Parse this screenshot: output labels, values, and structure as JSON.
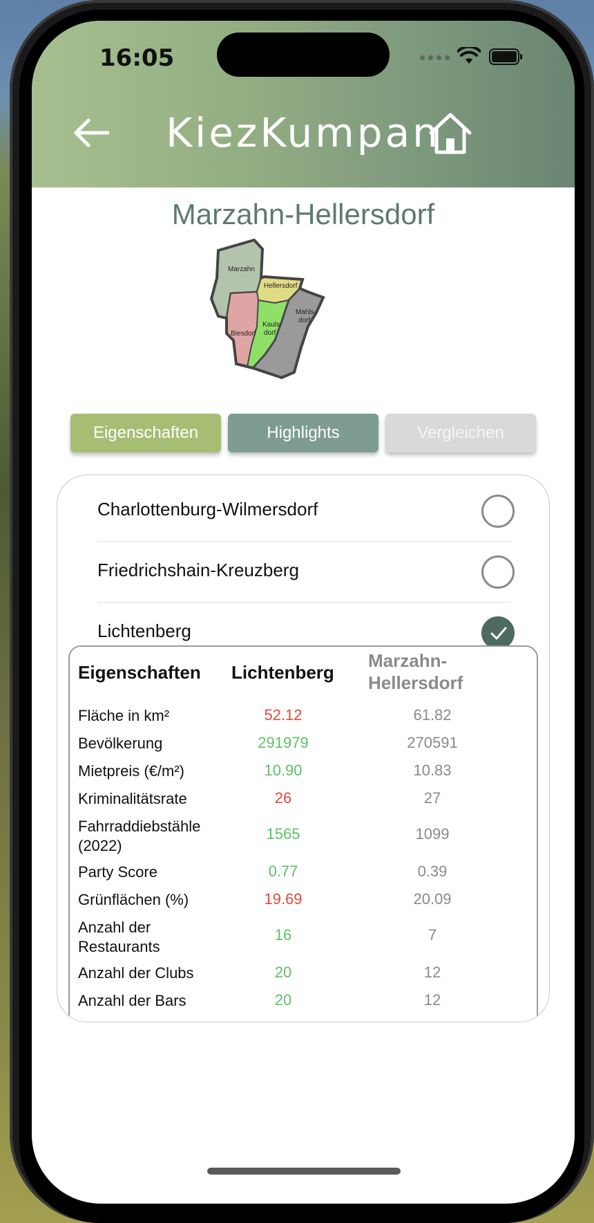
{
  "status_bar": {
    "time": "16:05"
  },
  "header": {
    "app_title": "KiezKumpan"
  },
  "district": {
    "title": "Marzahn-Hellersdorf",
    "map_labels": [
      "Marzahn",
      "Hellersdorf",
      "Biesdorf",
      "Kauls-",
      "dorf",
      "Mahls-",
      "dorf"
    ]
  },
  "tabs": [
    {
      "label": "Eigenschaften",
      "state": "active"
    },
    {
      "label": "Highlights",
      "state": "normal"
    },
    {
      "label": "Vergleichen",
      "state": "disabled"
    }
  ],
  "compare_options": [
    {
      "label": "Charlottenburg-Wilmersdorf",
      "selected": false
    },
    {
      "label": "Friedrichshain-Kreuzberg",
      "selected": false
    },
    {
      "label": "Lichtenberg",
      "selected": true
    }
  ],
  "table": {
    "header": {
      "name": "Eigenschaften",
      "a": "Lichtenberg",
      "b_line1": "Marzahn-",
      "b_line2": "Hellersdorf"
    },
    "rows": [
      {
        "name": "Fläche in km²",
        "a": "52.12",
        "b": "61.82",
        "a_status": "worse"
      },
      {
        "name": "Bevölkerung",
        "a": "291979",
        "b": "270591",
        "a_status": "better"
      },
      {
        "name": "Mietpreis (€/m²)",
        "a": "10.90",
        "b": "10.83",
        "a_status": "better"
      },
      {
        "name": "Kriminalitätsrate",
        "a": "26",
        "b": "27",
        "a_status": "worse"
      },
      {
        "name_line1": "Fahrraddiebstähle",
        "name_line2": "(2022)",
        "a": "1565",
        "b": "1099",
        "a_status": "better"
      },
      {
        "name": "Party Score",
        "a": "0.77",
        "b": "0.39",
        "a_status": "better"
      },
      {
        "name": "Grünflächen (%)",
        "a": "19.69",
        "b": "20.09",
        "a_status": "worse"
      },
      {
        "name_line1": "Anzahl der",
        "name_line2": "Restaurants",
        "a": "16",
        "b": "7",
        "a_status": "better"
      },
      {
        "name": "Anzahl der Clubs",
        "a": "20",
        "b": "12",
        "a_status": "better"
      },
      {
        "name": "Anzahl der Bars",
        "a": "20",
        "b": "12",
        "a_status": "better"
      }
    ]
  },
  "colors": {
    "better": "#5ac265",
    "worse": "#e2483d",
    "tab_active": "#a8bd74",
    "tab_highlights": "#7e9c94",
    "radio_checked": "#4d6b63"
  }
}
